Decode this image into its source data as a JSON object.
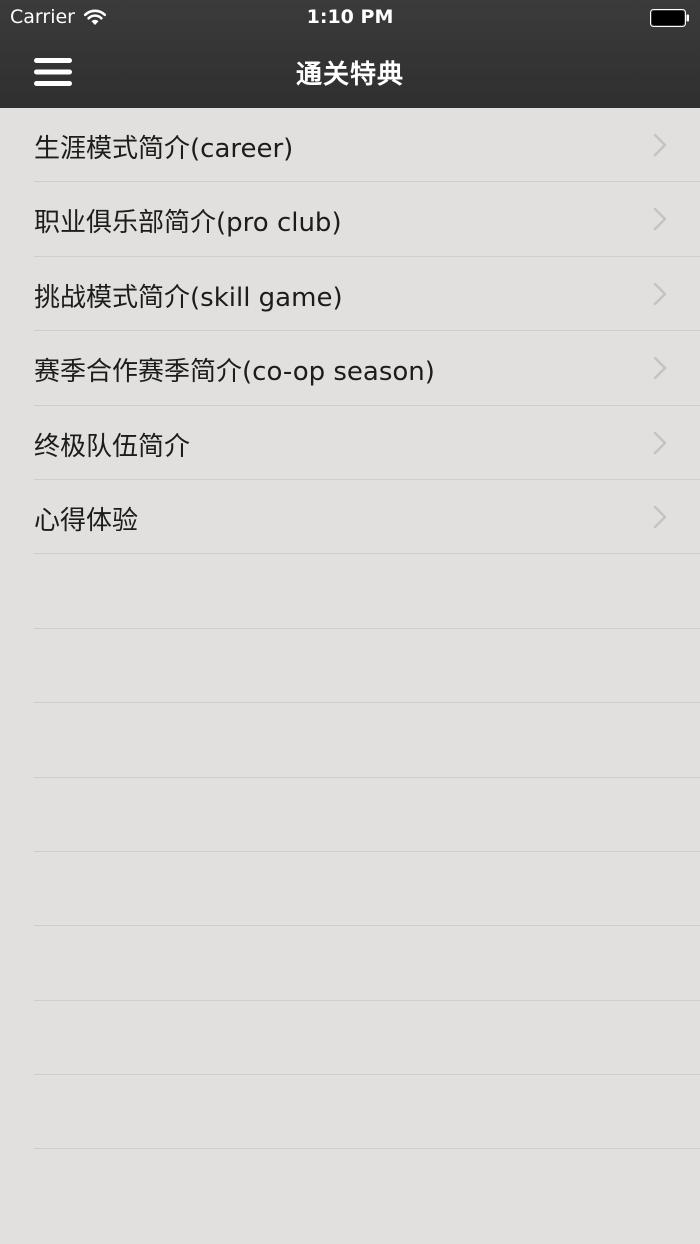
{
  "status_bar": {
    "carrier": "Carrier",
    "time": "1:10 PM",
    "icons": [
      "wifi-icon",
      "battery-icon"
    ]
  },
  "nav_bar": {
    "title": "通关特典",
    "menu_icon": "hamburger-menu-icon"
  },
  "list": {
    "items": [
      {
        "label": "生涯模式简介(career)"
      },
      {
        "label": "职业俱乐部简介(pro club)"
      },
      {
        "label": "挑战模式简介(skill game)"
      },
      {
        "label": "赛季合作赛季简介(co-op season)"
      },
      {
        "label": "终极队伍简介"
      },
      {
        "label": "心得体验"
      }
    ],
    "row_icon": "chevron-right-icon"
  },
  "colors": {
    "header_bg": "#333333",
    "list_bg": "#e1e0de",
    "separator": "#cfcecc",
    "chevron": "#c4c3c1",
    "text": "#1c1c1c"
  }
}
